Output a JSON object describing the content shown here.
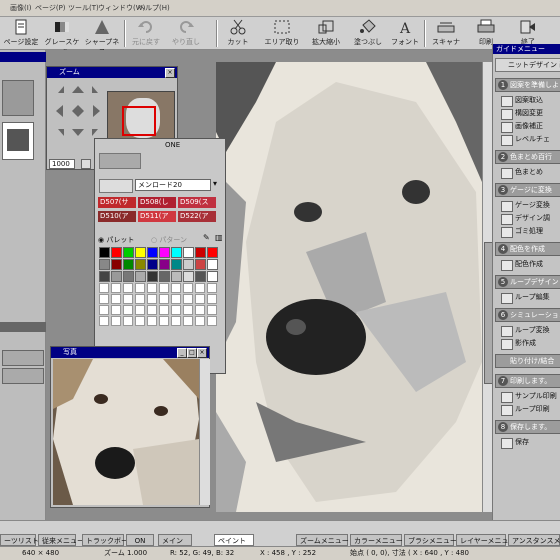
{
  "menus": [
    "画像(I)",
    "ページ(P)",
    "ツール(T)",
    "ウィンドウ(W)",
    "ヘルプ(H)"
  ],
  "toolbar": {
    "left_buttons": [
      "ページ設定",
      "グレースケール",
      "シャープネス"
    ],
    "disabled_buttons": [
      "元に戻す",
      "やり直し"
    ],
    "right_buttons": [
      "カット",
      "エリア取り",
      "拡大縮小",
      "塗つぶし",
      "フォント",
      "スキャナ",
      "印刷",
      "終了"
    ]
  },
  "zoom_window": {
    "title": "ズーム",
    "zoom_value": "1000"
  },
  "color_window": {
    "header": "ONE",
    "font_select": "メンロード20",
    "codes": [
      "D507(サ",
      "D508(し",
      "D509(ス",
      "D510(ア",
      "D511(ア",
      "D522(ア"
    ],
    "tabs": [
      "パレット",
      "パターン"
    ]
  },
  "photo_window": {
    "title": "写真"
  },
  "right_panel": {
    "title": "ガイドメニュー",
    "tab_label": "ニットデザイン 画像",
    "sections": [
      {
        "num": "1",
        "label": "図案を準備しよう",
        "items": [
          "図案取込",
          "構図変更",
          "画像補正",
          "レベルチェ"
        ]
      },
      {
        "num": "2",
        "label": "色まとめ百行",
        "items": [
          "色まとめ"
        ]
      },
      {
        "num": "3",
        "label": "ゲージに変換",
        "items": [
          "ゲージ変換",
          "デザイン調",
          "ゴミ処理"
        ]
      },
      {
        "num": "4",
        "label": "配色を作成",
        "items": [
          "配色作成"
        ]
      },
      {
        "num": "5",
        "label": "ループデザイン",
        "items": [
          "ループ編集"
        ]
      },
      {
        "num": "6",
        "label": "シミュレーション",
        "items": [
          "ループ変換",
          "影作成"
        ]
      },
      {
        "num": "",
        "label": "貼り付け/結合",
        "items": []
      },
      {
        "num": "7",
        "label": "印刷します。",
        "items": [
          "サンプル印刷",
          "ループ印刷"
        ]
      },
      {
        "num": "8",
        "label": "保存します。",
        "items": [
          "保存"
        ]
      }
    ]
  },
  "bottom_bar": [
    "ーツリスト",
    "従来メニュー",
    "トラックボール",
    "ON",
    "メイン",
    "ペイント",
    "ズームメニュー",
    "カラーメニュー",
    "ブラシメニュー",
    "レイヤーメニュー",
    "アンスタンスメニュー"
  ],
  "status": {
    "size": "640 × 480",
    "zoom": "ズーム 1.000",
    "rgb": "R: 52, G: 49, B: 32",
    "xy": "X : 458 , Y : 252",
    "origin": "始点 ( 0, 0), 寸法 ( X : 640 , Y : 480"
  },
  "colors": {
    "title_bar": "#000084",
    "dog_light": "#e9e5dc",
    "dog_dark": "#222222"
  }
}
